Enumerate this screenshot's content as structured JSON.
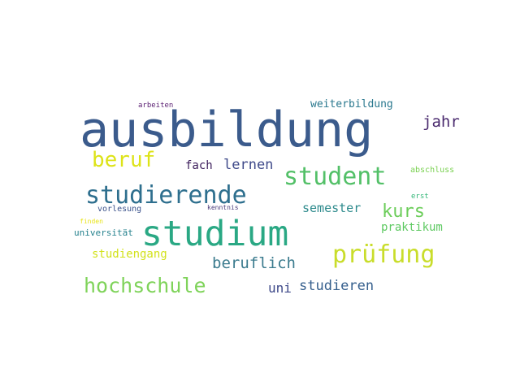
{
  "words": [
    {
      "text": "ausbildung",
      "color": "#3b5b8c"
    },
    {
      "text": "studium",
      "color": "#2aa884"
    },
    {
      "text": "studierende",
      "color": "#2e6f8e"
    },
    {
      "text": "student",
      "color": "#53c068"
    },
    {
      "text": "prüfung",
      "color": "#c9dd2b"
    },
    {
      "text": "hochschule",
      "color": "#7fd35a"
    },
    {
      "text": "beruf",
      "color": "#dde318"
    },
    {
      "text": "beruflich",
      "color": "#3b7b8e"
    },
    {
      "text": "kurs",
      "color": "#6ccd5a"
    },
    {
      "text": "jahr",
      "color": "#4a2a6e"
    },
    {
      "text": "lernen",
      "color": "#3f4a8a"
    },
    {
      "text": "studieren",
      "color": "#355f8d"
    },
    {
      "text": "semester",
      "color": "#2d8a8c"
    },
    {
      "text": "fach",
      "color": "#3b1c5a"
    },
    {
      "text": "praktikum",
      "color": "#5ec962"
    },
    {
      "text": "uni",
      "color": "#3e4989"
    },
    {
      "text": "studiengang",
      "color": "#d2e21b"
    },
    {
      "text": "weiterbildung",
      "color": "#2a788e"
    },
    {
      "text": "abschluss",
      "color": "#7ad151"
    },
    {
      "text": "universität",
      "color": "#26828e"
    },
    {
      "text": "vorlesung",
      "color": "#3b528b"
    },
    {
      "text": "arbeiten",
      "color": "#5a1f72"
    },
    {
      "text": "kenntnis",
      "color": "#4a3b7a"
    },
    {
      "text": "erst",
      "color": "#35b779"
    },
    {
      "text": "finden",
      "color": "#e8e419"
    }
  ]
}
